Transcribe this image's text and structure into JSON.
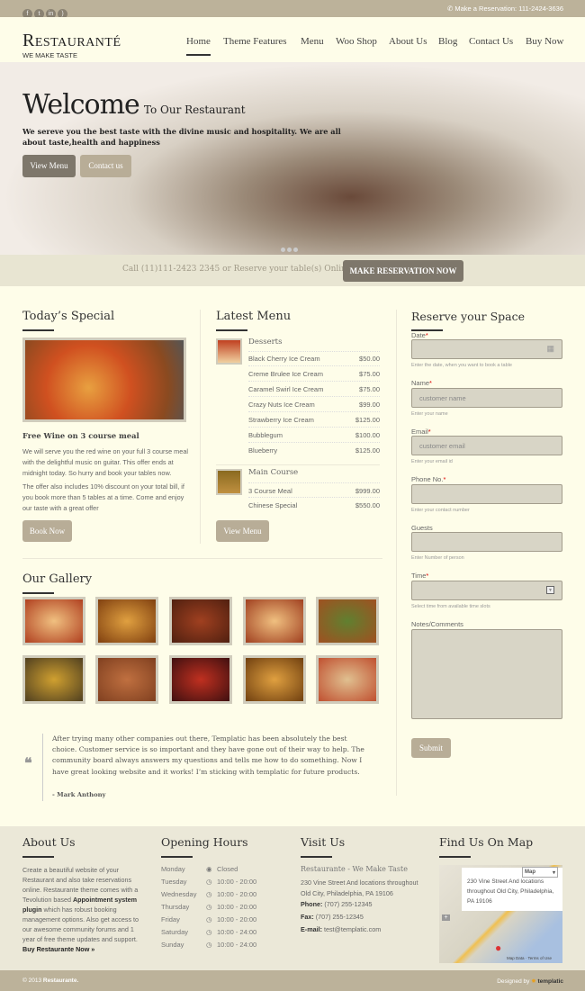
{
  "topbar": {
    "social": [
      "facebook-icon",
      "twitter-icon",
      "linkedin-icon",
      "rss-icon"
    ],
    "reservation": "Make a Reservation: 111-2424-3636"
  },
  "header": {
    "logo": "Restauranté",
    "tagline": "WE MAKE TASTE",
    "nav": [
      "Home",
      "Theme Features",
      "Menu",
      "Woo Shop",
      "About Us",
      "Blog",
      "Contact Us",
      "Buy Now"
    ],
    "active": "Home"
  },
  "hero": {
    "title": "Welcome",
    "subtitle": "To Our Restaurant",
    "text": "We sereve you the best taste with the divine music and hospitality. We are all about taste,health and happiness",
    "buttons": [
      "View Menu",
      "Contact us"
    ]
  },
  "cta": {
    "text": "Call (11)111-2423 2345 or Reserve your table(s) Online",
    "button": "MAKE RESERVATION NOW"
  },
  "special": {
    "title": "Today’s Special",
    "heading": "Free Wine on 3 course meal",
    "p1": "We will serve you the red wine on your full 3 course meal with the delightful music on guitar. This offer ends at midnight today. So hurry and book your tables now.",
    "p2": "The offer also includes 10% discount on your total bill, if you book more than 5 tables at a time. Come and enjoy our taste with a great offer",
    "button": "Book Now"
  },
  "menu": {
    "title": "Latest Menu",
    "button": "View Menu",
    "categories": [
      {
        "name": "Desserts",
        "items": [
          [
            "Black Cherry Ice Cream",
            "$50.00"
          ],
          [
            "Creme Brulee Ice Cream",
            "$75.00"
          ],
          [
            "Caramel Swirl Ice Cream",
            "$75.00"
          ],
          [
            "Crazy Nuts Ice Cream",
            "$99.00"
          ],
          [
            "Strawberry Ice Cream",
            "$125.00"
          ],
          [
            "Bubblegum",
            "$100.00"
          ],
          [
            "Blueberry",
            "$125.00"
          ]
        ]
      },
      {
        "name": "Main Course",
        "items": [
          [
            "3 Course Meal",
            "$999.00"
          ],
          [
            "Chinese Special",
            "$550.00"
          ]
        ]
      }
    ]
  },
  "reserve": {
    "title": "Reserve your Space",
    "fields": [
      {
        "label": "Date",
        "required": true,
        "placeholder": "",
        "hint": "Enter the date, when you want to book a table"
      },
      {
        "label": "Name",
        "required": true,
        "placeholder": "customer name",
        "hint": "Enter your name"
      },
      {
        "label": "Email",
        "required": true,
        "placeholder": "customer email",
        "hint": "Enter your email id"
      },
      {
        "label": "Phone No.",
        "required": true,
        "placeholder": "",
        "hint": "Enter your contact number"
      },
      {
        "label": "Guests",
        "required": false,
        "placeholder": "",
        "hint": "Enter Number of person"
      },
      {
        "label": "Time",
        "required": true,
        "placeholder": "",
        "hint": "Select time from available time slots"
      }
    ],
    "notes_label": "Notes/Comments",
    "submit": "Submit"
  },
  "gallery": {
    "title": "Our Gallery"
  },
  "testimonial": {
    "text": "After trying many other companies out there, Templatic has been absolutely the best choice. Customer service is so important and they have gone out of their way to help. The community board always answers my questions and tells me how to do something. Now I have great looking website and it works! I’m sticking with templatic for future products.",
    "author": "- Mark Anthony"
  },
  "footer": {
    "about": {
      "title": "About Us",
      "text1": "Create a beautiful website of your Restaurant and also take reservations online. Restaurante theme comes with a Tevolution based ",
      "bold": "Appointment system plugin",
      "text2": " which has robust booking management options. Also get access to our awesome community forums and 1 year of free theme updates and support.",
      "link": "Buy Restaurante Now »"
    },
    "hours": {
      "title": "Opening Hours",
      "days": [
        [
          "Monday",
          "Closed"
        ],
        [
          "Tuesday",
          "10:00 - 20:00"
        ],
        [
          "Wednesday",
          "10:00 - 20:00"
        ],
        [
          "Thursday",
          "10:00 - 20:00"
        ],
        [
          "Friday",
          "10:00 - 20:00"
        ],
        [
          "Saturday",
          "10:00 - 24:00"
        ],
        [
          "Sunday",
          "10:00 - 24:00"
        ]
      ]
    },
    "visit": {
      "title": "Visit Us",
      "name": "Restaurante - We Make Taste",
      "address": "230 Vine Street And locations throughout Old City, Philadelphia, PA 19106",
      "phone_label": "Phone:",
      "phone": "(707) 255-12345",
      "fax_label": "Fax:",
      "fax": "(707) 255-12345",
      "email_label": "E-mail:",
      "email": "test@templatic.com"
    },
    "map": {
      "title": "Find Us On Map",
      "type": "Map",
      "bubble": "230 Vine Street And locations throughout Old City, Philadelphia, PA 19106",
      "links": [
        "Map Data",
        "Terms of Use"
      ]
    }
  },
  "bottom": {
    "copyright": "© 2013",
    "brand": "Restaurante.",
    "designed": "Designed by",
    "designer": "templatic"
  },
  "colors": {
    "accent": "#b8ad97",
    "topbar": "#bcb29a",
    "background": "#fefde9",
    "footer": "#ebe8d8"
  }
}
